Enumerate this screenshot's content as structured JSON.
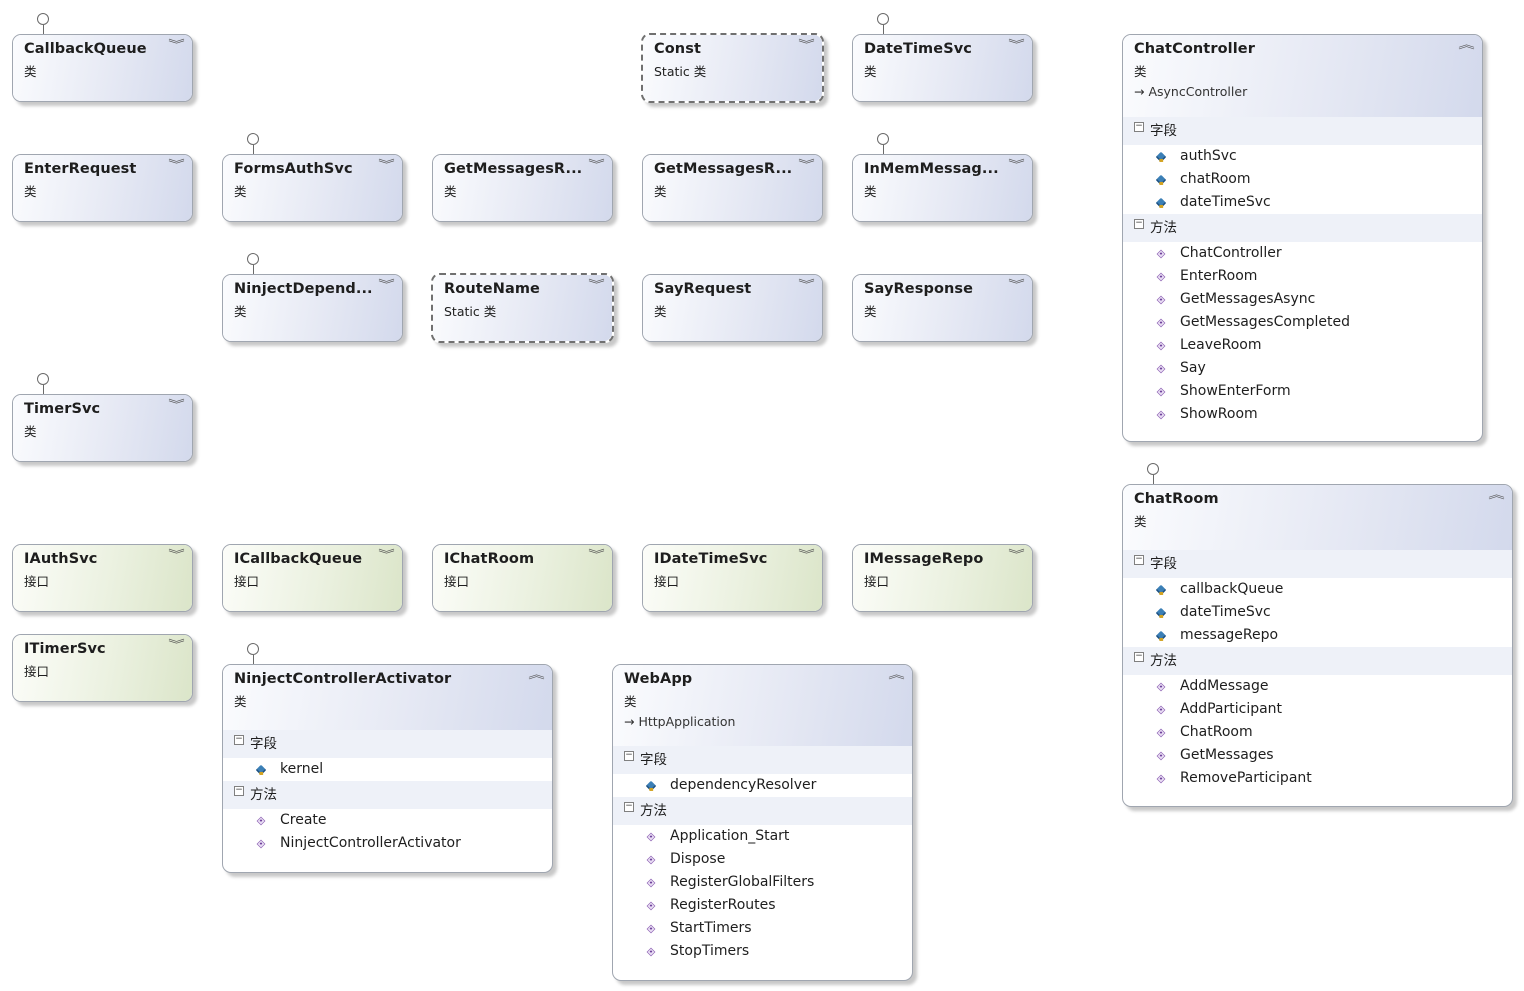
{
  "labels": {
    "class": "类",
    "static_class": "Static 类",
    "interface": "接口",
    "fields": "字段",
    "methods": "方法"
  },
  "collapsed": {
    "callbackqueue": "CallbackQueue",
    "const": "Const",
    "datetimesvc": "DateTimeSvc",
    "enterrequest": "EnterRequest",
    "formsauthsvc": "FormsAuthSvc",
    "getmessagesr1": "GetMessagesR...",
    "getmessagesr2": "GetMessagesR...",
    "inmemmessag": "InMemMessag...",
    "ninjectdepend": "NinjectDepend...",
    "routename": "RouteName",
    "sayrequest": "SayRequest",
    "sayresponse": "SayResponse",
    "timersvc": "TimerSvc",
    "iauthsvc": "IAuthSvc",
    "icallbackqueue": "ICallbackQueue",
    "ichatroom": "IChatRoom",
    "idatetimesvc": "IDateTimeSvc",
    "imessagerepo": "IMessageRepo",
    "itimersvc": "ITimerSvc"
  },
  "chatcontroller": {
    "name": "ChatController",
    "base": "AsyncController",
    "fields": [
      "authSvc",
      "chatRoom",
      "dateTimeSvc"
    ],
    "methods": [
      "ChatController",
      "EnterRoom",
      "GetMessagesAsync",
      "GetMessagesCompleted",
      "LeaveRoom",
      "Say",
      "ShowEnterForm",
      "ShowRoom"
    ]
  },
  "chatroom": {
    "name": "ChatRoom",
    "fields": [
      "callbackQueue",
      "dateTimeSvc",
      "messageRepo"
    ],
    "methods": [
      "AddMessage",
      "AddParticipant",
      "ChatRoom",
      "GetMessages",
      "RemoveParticipant"
    ]
  },
  "ninjectcontrolleractivator": {
    "name": "NinjectControllerActivator",
    "fields": [
      "kernel"
    ],
    "methods": [
      "Create",
      "NinjectControllerActivator"
    ]
  },
  "webapp": {
    "name": "WebApp",
    "base": "HttpApplication",
    "fields": [
      "dependencyResolver"
    ],
    "methods": [
      "Application_Start",
      "Dispose",
      "RegisterGlobalFilters",
      "RegisterRoutes",
      "StartTimers",
      "StopTimers"
    ]
  },
  "icons": {
    "collapsed_toggle": "double-chevron-down",
    "expanded_toggle": "double-chevron-up",
    "section_toggle": "minus-box",
    "field": "private-field-icon",
    "method": "method-icon",
    "interface_lollipop": "lollipop-icon"
  }
}
